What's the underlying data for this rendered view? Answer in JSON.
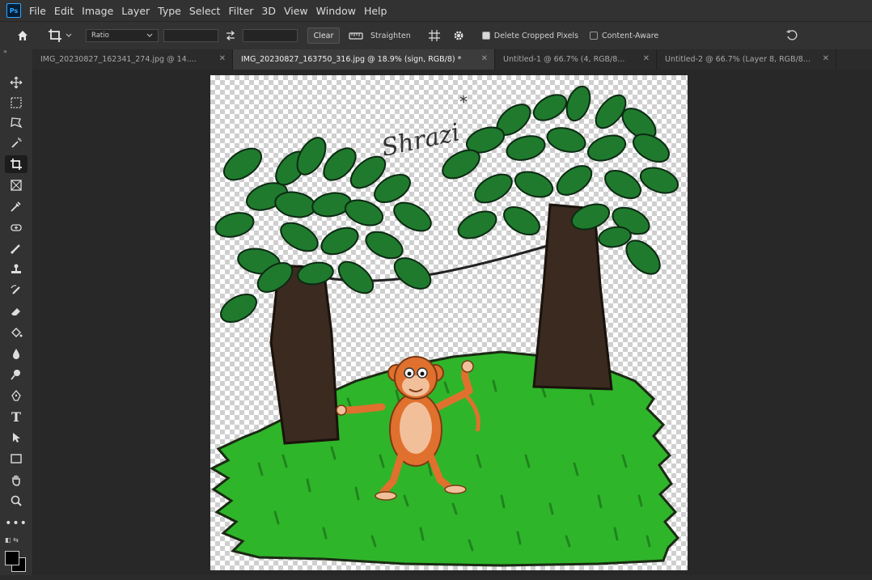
{
  "menu": [
    "File",
    "Edit",
    "Image",
    "Layer",
    "Type",
    "Select",
    "Filter",
    "3D",
    "View",
    "Window",
    "Help"
  ],
  "options": {
    "ratio_label": "Ratio",
    "clear_label": "Clear",
    "straighten_label": "Straighten",
    "delete_cropped_label": "Delete Cropped Pixels",
    "delete_cropped_checked": true,
    "content_aware_label": "Content-Aware",
    "content_aware_checked": false
  },
  "tabs": [
    {
      "label": "IMG_20230827_162341_274.jpg @ 14....",
      "active": false
    },
    {
      "label": "IMG_20230827_163750_316.jpg @ 18.9% (sign, RGB/8) *",
      "active": true
    },
    {
      "label": "Untitled-1 @ 66.7% (4, RGB/8...",
      "active": false
    },
    {
      "label": "Untitled-2 @ 66.7% (Layer 8, RGB/8...",
      "active": false
    }
  ],
  "artwork": {
    "signature": "Shrazi"
  },
  "colors": {
    "grass": "#2fb52a",
    "leaf": "#1f7a2e",
    "trunk": "#3a2a1f",
    "monkey": "#e0702e",
    "belly": "#f1c09a"
  }
}
